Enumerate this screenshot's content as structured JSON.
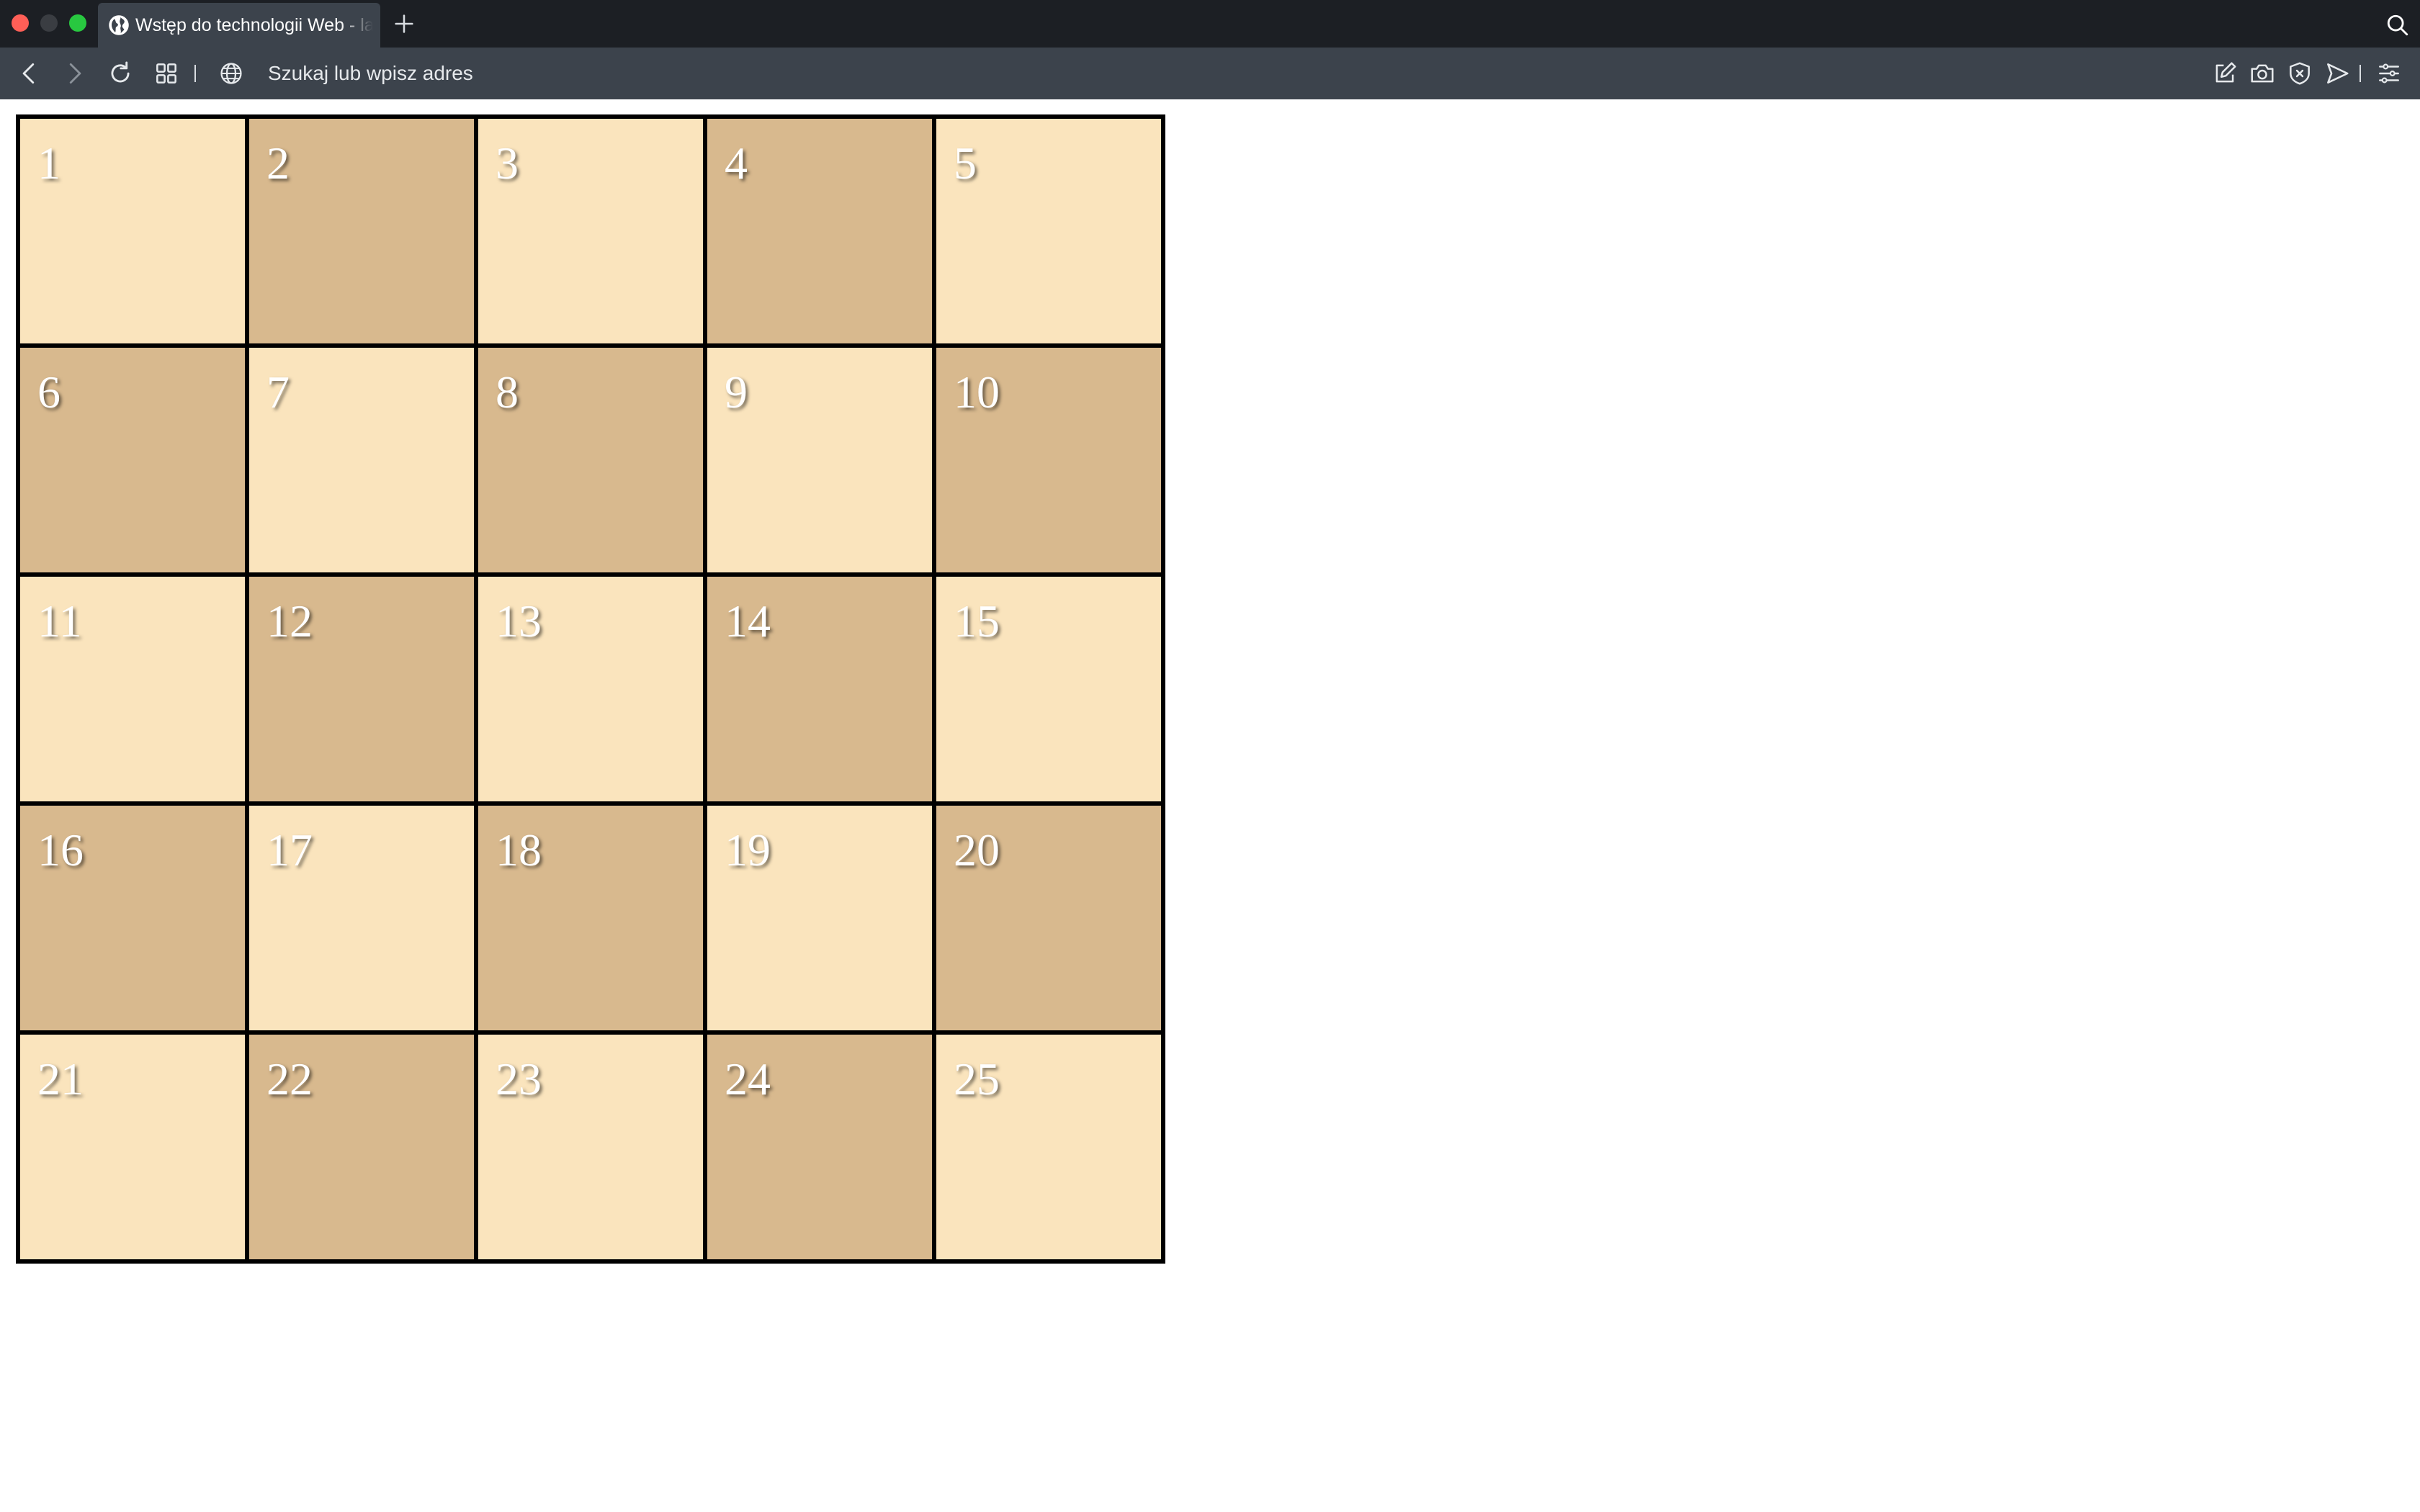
{
  "browser": {
    "tab": {
      "title": "Wstęp do technologii Web - lab",
      "favicon": "globe-icon"
    },
    "new_tab_icon": "plus-icon",
    "search_icon": "search-icon",
    "toolbar": {
      "back_icon": "chevron-left-icon",
      "forward_icon": "chevron-right-icon",
      "reload_icon": "reload-icon",
      "tabs_grid_icon": "grid-icon",
      "address_icon": "globe-icon",
      "address_placeholder": "Szukaj lub wpisz adres",
      "right_icons": [
        "edit-icon",
        "camera-icon",
        "shield-icon",
        "send-icon",
        "menu-icon"
      ]
    },
    "colors": {
      "traffic_close": "#ff5f57",
      "traffic_minimize": "#3a3d42",
      "traffic_maximize": "#28c840",
      "tabstrip_bg": "#1c1f24",
      "toolbar_bg": "#3c434c"
    }
  },
  "board": {
    "columns": 5,
    "rows": 5,
    "colors": {
      "light": "#fae4bd",
      "dark": "#d8b98e",
      "border": "#000000",
      "number": "#ffffff"
    },
    "cells": [
      {
        "label": "1",
        "shade": "light"
      },
      {
        "label": "2",
        "shade": "dark"
      },
      {
        "label": "3",
        "shade": "light"
      },
      {
        "label": "4",
        "shade": "dark"
      },
      {
        "label": "5",
        "shade": "light"
      },
      {
        "label": "6",
        "shade": "dark"
      },
      {
        "label": "7",
        "shade": "light"
      },
      {
        "label": "8",
        "shade": "dark"
      },
      {
        "label": "9",
        "shade": "light"
      },
      {
        "label": "10",
        "shade": "dark"
      },
      {
        "label": "11",
        "shade": "light"
      },
      {
        "label": "12",
        "shade": "dark"
      },
      {
        "label": "13",
        "shade": "light"
      },
      {
        "label": "14",
        "shade": "dark"
      },
      {
        "label": "15",
        "shade": "light"
      },
      {
        "label": "16",
        "shade": "dark"
      },
      {
        "label": "17",
        "shade": "light"
      },
      {
        "label": "18",
        "shade": "dark"
      },
      {
        "label": "19",
        "shade": "light"
      },
      {
        "label": "20",
        "shade": "dark"
      },
      {
        "label": "21",
        "shade": "light"
      },
      {
        "label": "22",
        "shade": "dark"
      },
      {
        "label": "23",
        "shade": "light"
      },
      {
        "label": "24",
        "shade": "dark"
      },
      {
        "label": "25",
        "shade": "light"
      }
    ]
  }
}
